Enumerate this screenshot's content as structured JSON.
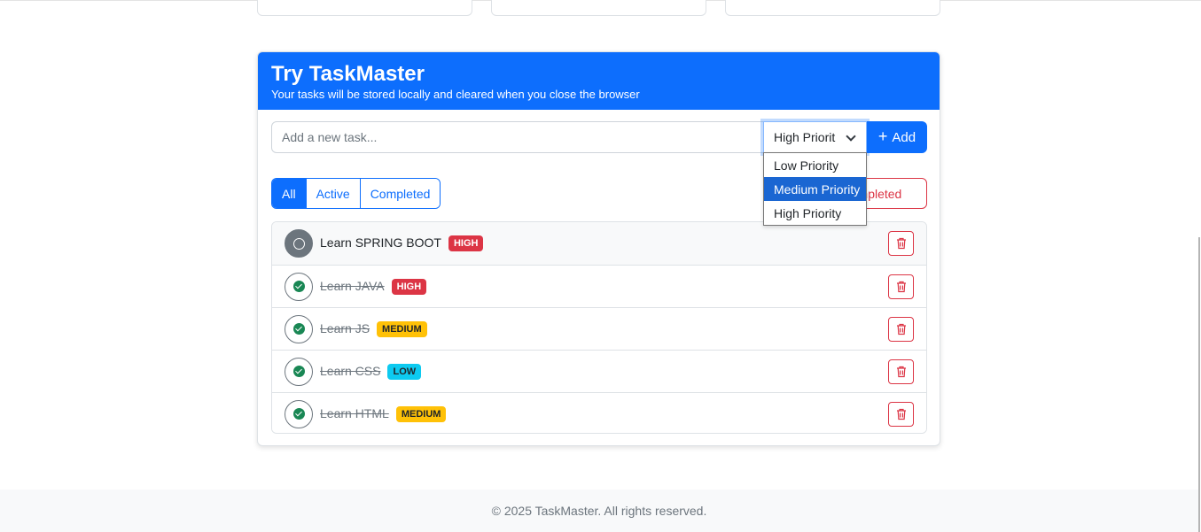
{
  "colors": {
    "primary": "#0d6efd",
    "danger": "#dc3545",
    "warning": "#ffc107",
    "info": "#0dcaf0",
    "success": "#198754",
    "secondary": "#6c757d"
  },
  "demo": {
    "title": "Try TaskMaster",
    "subtitle": "Your tasks will be stored locally and cleared when you close the browser",
    "input_placeholder": "Add a new task...",
    "priority_selected": "High Priorit",
    "add_label": "Add",
    "filters": [
      "All",
      "Active",
      "Completed"
    ],
    "clear_label": "Completed",
    "priority_options": [
      "Low Priority",
      "Medium Priority",
      "High Priority"
    ],
    "tasks": [
      {
        "text": "Learn SPRING BOOT",
        "badge": "HIGH",
        "completed": false,
        "toggle_icon": "circle-icon",
        "delete_icon": "trash-icon"
      },
      {
        "text": "Learn JAVA",
        "badge": "HIGH",
        "completed": true,
        "toggle_icon": "check-circle-icon",
        "delete_icon": "trash-icon"
      },
      {
        "text": "Learn JS",
        "badge": "MEDIUM",
        "completed": true,
        "toggle_icon": "check-circle-icon",
        "delete_icon": "trash-icon"
      },
      {
        "text": "Learn CSS",
        "badge": "LOW",
        "completed": true,
        "toggle_icon": "check-circle-icon",
        "delete_icon": "trash-icon"
      },
      {
        "text": "Learn HTML",
        "badge": "MEDIUM",
        "completed": true,
        "toggle_icon": "check-circle-icon",
        "delete_icon": "trash-icon"
      }
    ]
  },
  "footer": {
    "text": "© 2025 TaskMaster. All rights reserved."
  }
}
